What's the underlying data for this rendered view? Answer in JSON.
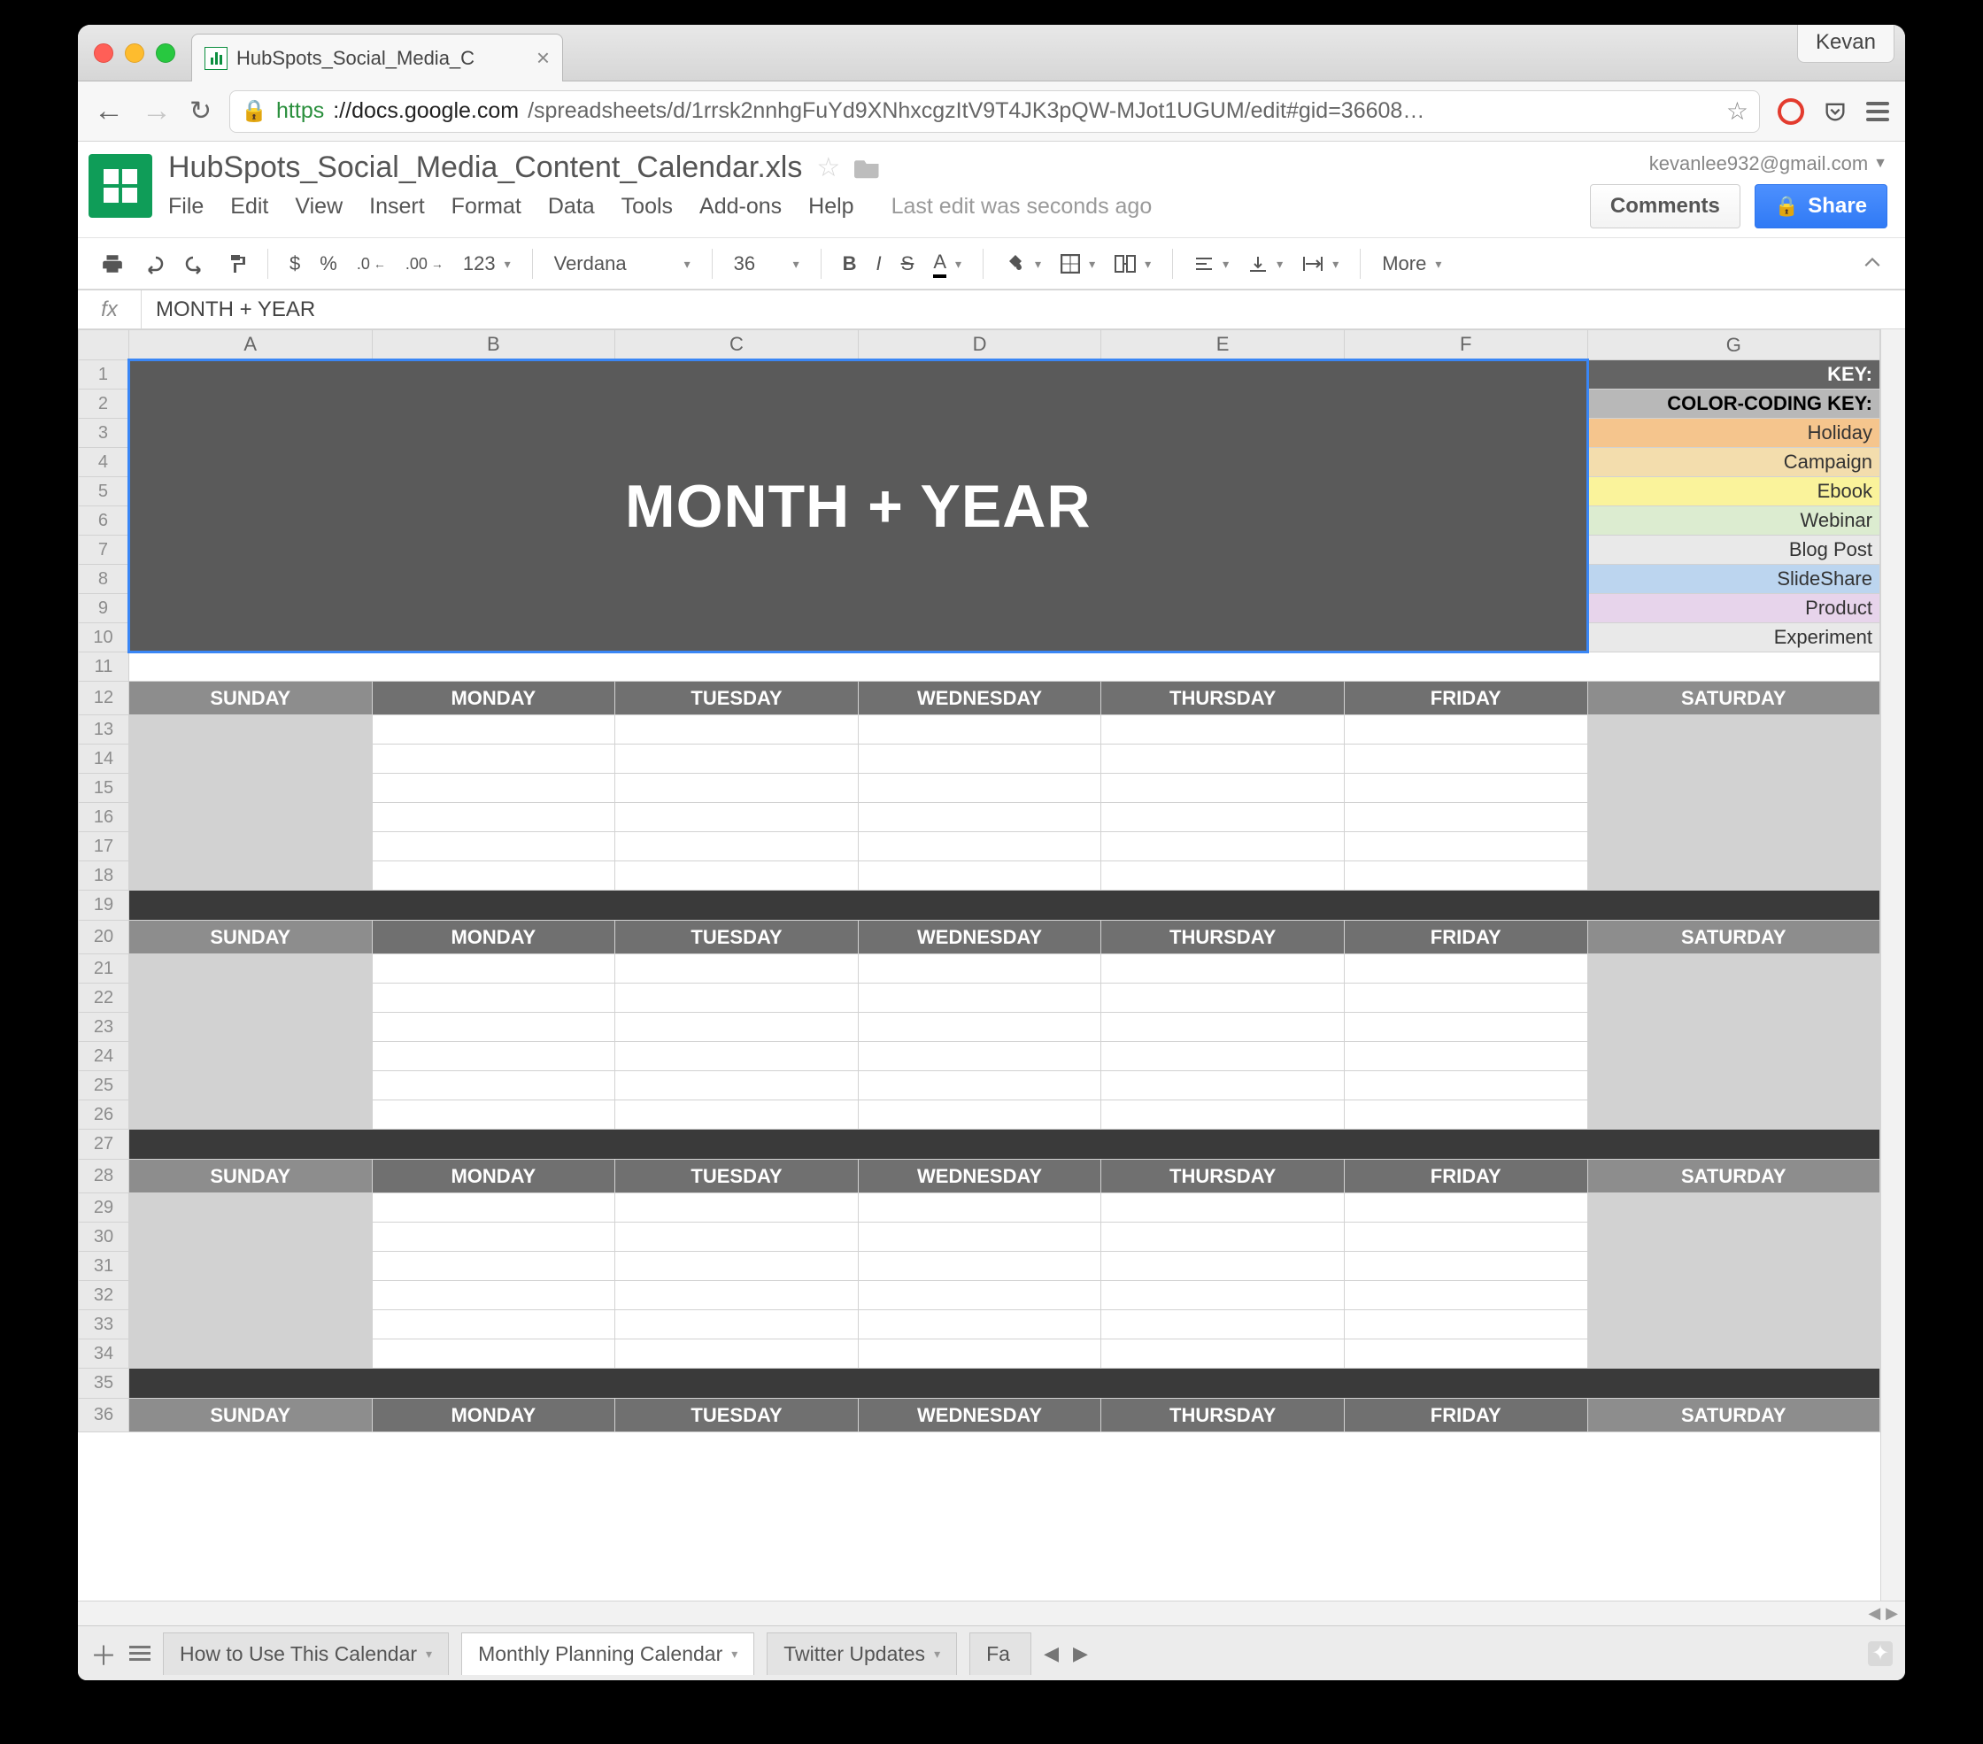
{
  "os_user": "Kevan",
  "browser_tab_title": "HubSpots_Social_Media_C",
  "url_proto": "https",
  "url_host": "://docs.google.com",
  "url_path": "/spreadsheets/d/1rrsk2nnhgFuYd9XNhxcgzItV9T4JK3pQW-MJot1UGUM/edit#gid=36608…",
  "doc_title": "HubSpots_Social_Media_Content_Calendar.xls",
  "account_email": "kevanlee932@gmail.com",
  "menus": {
    "file": "File",
    "edit": "Edit",
    "view": "View",
    "insert": "Insert",
    "format": "Format",
    "data": "Data",
    "tools": "Tools",
    "addons": "Add-ons",
    "help": "Help"
  },
  "last_edit": "Last edit was seconds ago",
  "buttons": {
    "comments": "Comments",
    "share": "Share"
  },
  "toolbar": {
    "currency": "$",
    "percent": "%",
    "dec_dec": ".0",
    "dec_inc": ".00",
    "num": "123",
    "font": "Verdana",
    "size": "36",
    "more": "More"
  },
  "fx": "MONTH + YEAR",
  "col_labels": [
    "A",
    "B",
    "C",
    "D",
    "E",
    "F",
    "G"
  ],
  "row_labels": [
    "1",
    "2",
    "3",
    "4",
    "5",
    "6",
    "7",
    "8",
    "9",
    "10",
    "11",
    "12",
    "13",
    "14",
    "15",
    "16",
    "17",
    "18",
    "19",
    "20",
    "21",
    "22",
    "23",
    "24",
    "25",
    "26",
    "27",
    "28",
    "29",
    "30",
    "31",
    "32",
    "33",
    "34",
    "35",
    "36"
  ],
  "banner": "MONTH + YEAR",
  "key": {
    "header": "KEY:",
    "subheader": "COLOR-CODING KEY:",
    "items": [
      "Holiday",
      "Campaign",
      "Ebook",
      "Webinar",
      "Blog Post",
      "SlideShare",
      "Product",
      "Experiment"
    ]
  },
  "days": {
    "sun": "SUNDAY",
    "mon": "MONDAY",
    "tue": "TUESDAY",
    "wed": "WEDNESDAY",
    "thu": "THURSDAY",
    "fri": "FRIDAY",
    "sat": "SATURDAY"
  },
  "sheet_tabs": [
    "How to Use This Calendar",
    "Monthly Planning Calendar",
    "Twitter Updates",
    "Fa"
  ],
  "active_sheet": 1
}
